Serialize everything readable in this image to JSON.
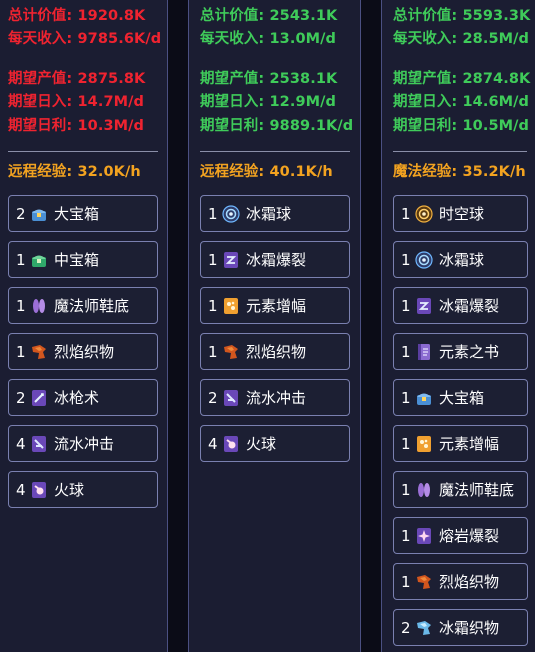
{
  "columns": [
    {
      "stats": [
        {
          "label": "总计价值",
          "value": "1920.8K",
          "color": "red"
        },
        {
          "label": "每天收入",
          "value": "9785.6K/d",
          "color": "red"
        },
        {
          "label": "期望产值",
          "value": "2875.8K",
          "color": "red"
        },
        {
          "label": "期望日入",
          "value": "14.7M/d",
          "color": "red"
        },
        {
          "label": "期望日利",
          "value": "10.3M/d",
          "color": "red"
        }
      ],
      "exp": {
        "label": "远程经验",
        "value": "32.0K/h"
      },
      "items": [
        {
          "qty": "2",
          "name": "大宝箱",
          "icon": "large-chest-icon"
        },
        {
          "qty": "1",
          "name": "中宝箱",
          "icon": "medium-chest-icon"
        },
        {
          "qty": "1",
          "name": "魔法师鞋底",
          "icon": "mage-sole-icon"
        },
        {
          "qty": "1",
          "name": "烈焰织物",
          "icon": "flame-fabric-icon"
        },
        {
          "qty": "2",
          "name": "冰枪术",
          "icon": "ice-spear-book-icon"
        },
        {
          "qty": "4",
          "name": "流水冲击",
          "icon": "water-strike-book-icon"
        },
        {
          "qty": "4",
          "name": "火球",
          "icon": "fireball-book-icon"
        }
      ]
    },
    {
      "stats": [
        {
          "label": "总计价值",
          "value": "2543.1K",
          "color": "green"
        },
        {
          "label": "每天收入",
          "value": "13.0M/d",
          "color": "green"
        },
        {
          "label": "期望产值",
          "value": "2538.1K",
          "color": "green"
        },
        {
          "label": "期望日入",
          "value": "12.9M/d",
          "color": "green"
        },
        {
          "label": "期望日利",
          "value": "9889.1K/d",
          "color": "green"
        }
      ],
      "exp": {
        "label": "远程经验",
        "value": "40.1K/h"
      },
      "items": [
        {
          "qty": "1",
          "name": "冰霜球",
          "icon": "frost-orb-icon"
        },
        {
          "qty": "1",
          "name": "冰霜爆裂",
          "icon": "frost-burst-book-icon"
        },
        {
          "qty": "1",
          "name": "元素增幅",
          "icon": "elemental-amplify-book-icon"
        },
        {
          "qty": "1",
          "name": "烈焰织物",
          "icon": "flame-fabric-icon"
        },
        {
          "qty": "2",
          "name": "流水冲击",
          "icon": "water-strike-book-icon"
        },
        {
          "qty": "4",
          "name": "火球",
          "icon": "fireball-book-icon"
        }
      ]
    },
    {
      "stats": [
        {
          "label": "总计价值",
          "value": "5593.3K",
          "color": "green"
        },
        {
          "label": "每天收入",
          "value": "28.5M/d",
          "color": "green"
        },
        {
          "label": "期望产值",
          "value": "2874.8K",
          "color": "green"
        },
        {
          "label": "期望日入",
          "value": "14.6M/d",
          "color": "green"
        },
        {
          "label": "期望日利",
          "value": "10.5M/d",
          "color": "green"
        }
      ],
      "exp": {
        "label": "魔法经验",
        "value": "35.2K/h"
      },
      "items": [
        {
          "qty": "1",
          "name": "时空球",
          "icon": "time-space-orb-icon"
        },
        {
          "qty": "1",
          "name": "冰霜球",
          "icon": "frost-orb-icon"
        },
        {
          "qty": "1",
          "name": "冰霜爆裂",
          "icon": "frost-burst-book-icon"
        },
        {
          "qty": "1",
          "name": "元素之书",
          "icon": "elemental-book-icon"
        },
        {
          "qty": "1",
          "name": "大宝箱",
          "icon": "large-chest-icon"
        },
        {
          "qty": "1",
          "name": "元素增幅",
          "icon": "elemental-amplify-book-icon"
        },
        {
          "qty": "1",
          "name": "魔法师鞋底",
          "icon": "mage-sole-icon"
        },
        {
          "qty": "1",
          "name": "熔岩爆裂",
          "icon": "lava-burst-book-icon"
        },
        {
          "qty": "1",
          "name": "烈焰织物",
          "icon": "flame-fabric-icon"
        },
        {
          "qty": "2",
          "name": "冰霜织物",
          "icon": "frost-fabric-icon"
        }
      ]
    }
  ],
  "colors": {
    "red": "#ef2330",
    "green": "#3fcb5a",
    "orange": "#f3a320",
    "panel_bg": "#1b1d32",
    "item_border": "#7a80b0"
  }
}
